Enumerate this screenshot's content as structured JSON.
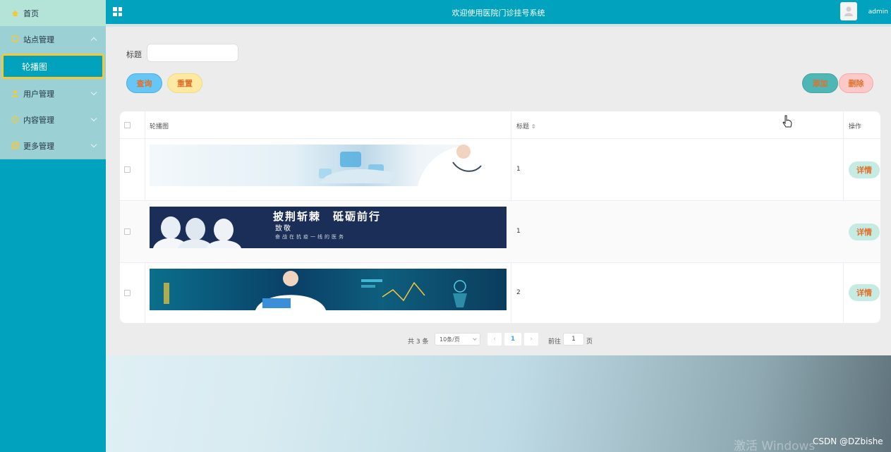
{
  "sidebar": {
    "home": "首页",
    "site_mgmt": "站点管理",
    "carousel": "轮播图",
    "user_mgmt": "用户管理",
    "content_mgmt": "内容管理",
    "more_mgmt": "更多管理"
  },
  "header": {
    "title": "欢迎使用医院门诊挂号系统",
    "user": "admin"
  },
  "search": {
    "label": "标题",
    "value": ""
  },
  "buttons": {
    "query": "查询",
    "reset": "重置",
    "add": "添加",
    "delete": "删除"
  },
  "table": {
    "col_image": "轮播图",
    "col_title": "标题",
    "col_action": "操作",
    "sort_icon": "sort-icon",
    "rows": [
      {
        "title": "1",
        "action": "详情"
      },
      {
        "title": "1",
        "action": "详情"
      },
      {
        "title": "2",
        "action": "详情"
      }
    ],
    "banner2": {
      "line1": "披荆斩棘　砥砺前行",
      "line2": "致敬",
      "line3": "奋战在抗疫一线的医务"
    }
  },
  "pagination": {
    "total": "共 3 条",
    "page_size": "10条/页",
    "current": "1",
    "goto_label": "前往",
    "goto_value": "1",
    "page_unit": "页"
  },
  "watermark": {
    "windows": "激活 Windows",
    "csdn": "CSDN @DZbishe"
  },
  "colors": {
    "primary": "#00a2bd",
    "menu_bg": "#9bd0d5",
    "active_border": "#f5c83a",
    "button_text": "#e0702a"
  }
}
